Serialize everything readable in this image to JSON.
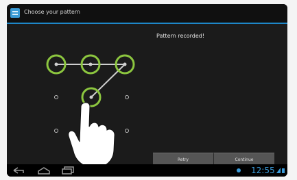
{
  "titlebar": {
    "title": "Choose your pattern",
    "icon": "app-menu-icon"
  },
  "main": {
    "status_text": "Pattern recorded!",
    "pattern_grid": {
      "rows": 3,
      "cols": 3,
      "selected_dots": [
        1,
        2,
        3,
        5
      ],
      "active_color": "#8cc63f"
    },
    "hand_icon": "pointing-hand-icon"
  },
  "buttons": {
    "retry_label": "Retry",
    "continue_label": "Continue"
  },
  "navbar": {
    "back_icon": "back-icon",
    "home_icon": "home-icon",
    "recent_icon": "recent-apps-icon",
    "clock": "12:55",
    "accent_color": "#3b9bd9"
  }
}
